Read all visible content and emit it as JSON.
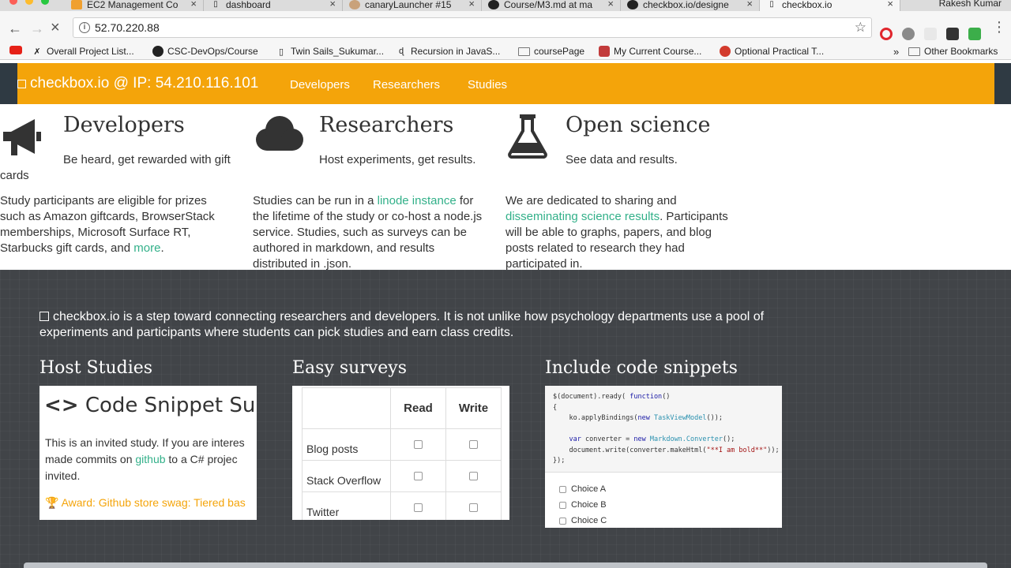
{
  "tabs": [
    {
      "title": "EC2 Management Co",
      "icon": "ec2-icon"
    },
    {
      "title": "dashboard",
      "icon": "page-icon"
    },
    {
      "title": "canaryLauncher #15",
      "icon": "jenkins-icon"
    },
    {
      "title": "Course/M3.md at ma",
      "icon": "github-icon"
    },
    {
      "title": "checkbox.io/designe",
      "icon": "github-icon"
    },
    {
      "title": "checkbox.io",
      "icon": "page-icon"
    }
  ],
  "profile_name": "Rakesh Kumar",
  "address_bar": {
    "url": "52.70.220.88"
  },
  "bookmarks": [
    {
      "label": "",
      "icon": "youtube-icon"
    },
    {
      "label": "Overall Project List...",
      "icon": "project-icon"
    },
    {
      "label": "CSC-DevOps/Course",
      "icon": "github-icon"
    },
    {
      "label": "Twin Sails_Sukumar...",
      "icon": "page-icon"
    },
    {
      "label": "Recursion in JavaS...",
      "icon": "doc-icon"
    },
    {
      "label": "coursePage",
      "icon": "folder-icon"
    },
    {
      "label": "My Current Course...",
      "icon": "course-icon"
    },
    {
      "label": "Optional Practical T...",
      "icon": "chrome-icon"
    }
  ],
  "bookmarks_overflow": "»",
  "other_bookmarks": "Other Bookmarks",
  "navbar": {
    "brand": "checkbox.io @ IP: 54.210.116.101",
    "links": [
      "Developers",
      "Researchers",
      "Studies"
    ]
  },
  "features": {
    "developers": {
      "title": "Developers",
      "tagline": "Be heard, get rewarded with gift cards",
      "body_1": "Study participants are eligible for prizes such as Amazon giftcards, BrowserStack memberships, Microsoft Surface RT, Starbucks gift cards, and ",
      "link": "more",
      "body_2": "."
    },
    "researchers": {
      "title": "Researchers",
      "tagline": "Host experiments, get results.",
      "body_1": "Studies can be run in a ",
      "link": "linode instance",
      "body_2": " for the lifetime of the study or co-host a node.js service. Studies, such as surveys can be authored in markdown, and results distributed in .json."
    },
    "open_science": {
      "title": "Open science",
      "tagline": "See data and results.",
      "body_1": "We are dedicated to sharing and ",
      "link": "disseminating science results",
      "body_2": ". Participants will be able to graphs, papers, and blog posts related to research they had participated in."
    }
  },
  "intro": "checkbox.io is a step toward connecting researchers and developers. It is not unlike how psychology departments use a pool of experiments and participants where students can pick studies and earn class credits.",
  "sections": {
    "host": {
      "title": "Host Studies",
      "snippet_title": "Code Snippet Su",
      "body_1": "This is an invited study. If you are interes",
      "body_2": "made commits on ",
      "link": "github",
      "body_3": " to a C# projec",
      "body_4": "invited.",
      "award": "Award: Github store swag: Tiered bas"
    },
    "surveys": {
      "title": "Easy surveys",
      "columns": [
        "Read",
        "Write"
      ],
      "rows": [
        "Blog posts",
        "Stack Overflow",
        "Twitter"
      ]
    },
    "code": {
      "title": "Include code snippets",
      "choices": [
        "Choice A",
        "Choice B",
        "Choice C"
      ]
    }
  },
  "colors": {
    "accent": "#f4a40a",
    "link": "#32b089",
    "dark_bg": "#414448"
  }
}
